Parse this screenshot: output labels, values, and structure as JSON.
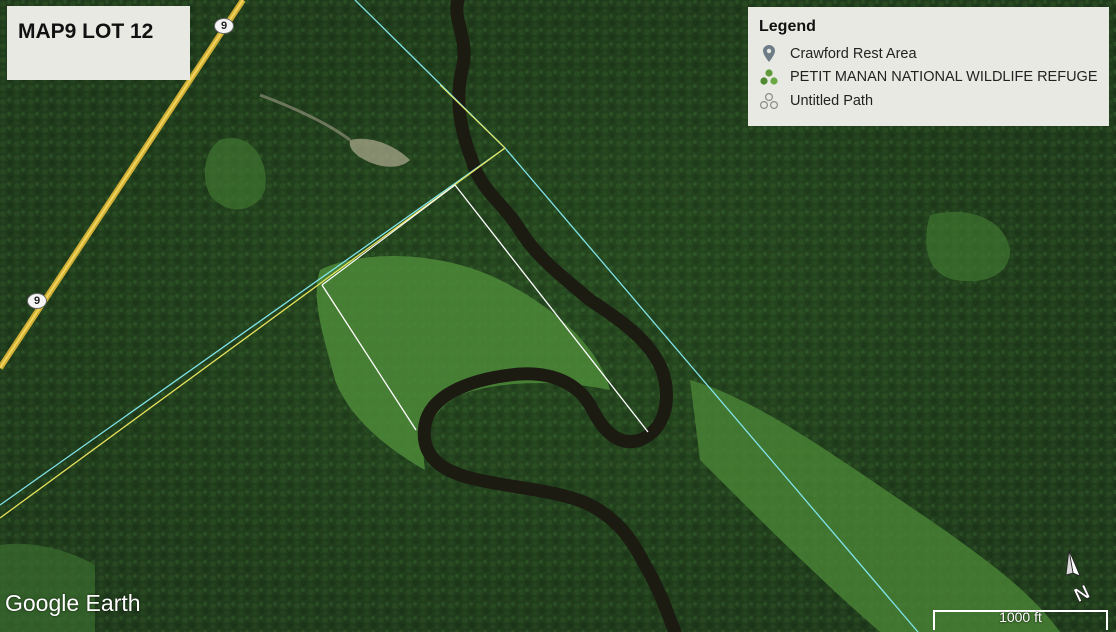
{
  "map": {
    "title": "MAP9 LOT 12",
    "road_shield": "9",
    "attribution": "Google Earth",
    "scale_label": "1000 ft",
    "north_label": "N"
  },
  "legend": {
    "title": "Legend",
    "items": [
      {
        "label": "Crawford Rest Area",
        "icon": "placemark-pin-icon"
      },
      {
        "label": "PETIT MANAN NATIONAL WILDLIFE REFUGE",
        "icon": "polygon-cluster-icon"
      },
      {
        "label": "Untitled Path",
        "icon": "path-cluster-icon"
      }
    ]
  },
  "colors": {
    "forest": "#24431f",
    "wetland": "#4f8a3a",
    "river": "#1b1b12",
    "road": "#e6c13a",
    "boundary_cyan": "#7fe3e9",
    "boundary_yellow": "#e7e25a",
    "path_white": "#ffffff"
  }
}
